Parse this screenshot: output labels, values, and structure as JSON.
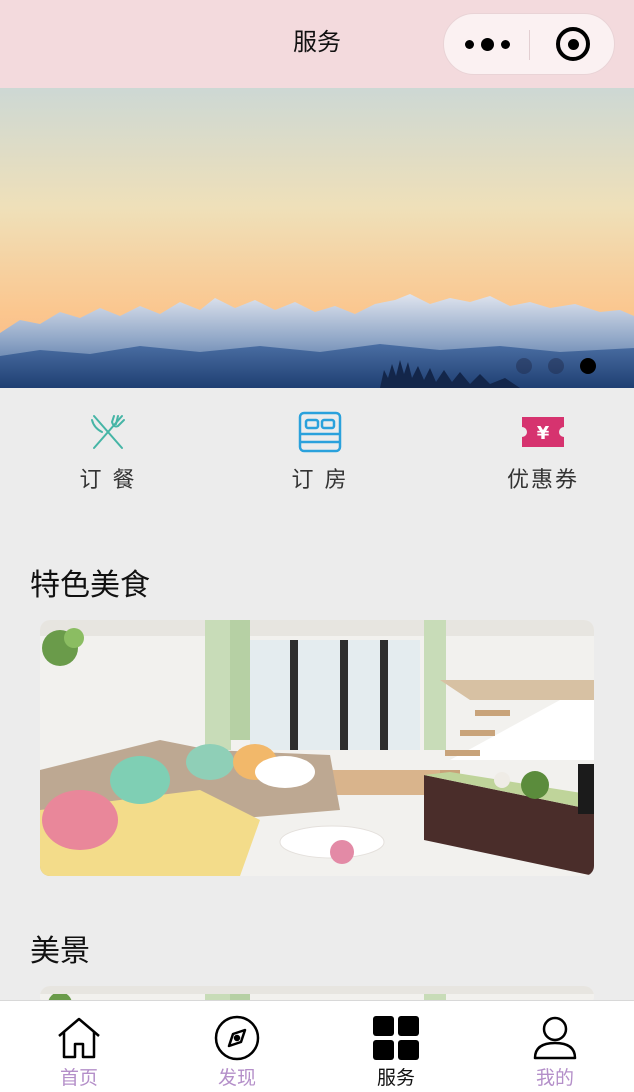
{
  "header": {
    "title": "服务"
  },
  "banner": {
    "slides": 3,
    "active_slide": 3
  },
  "services": [
    {
      "label": "订 餐",
      "icon": "fork-knife-icon"
    },
    {
      "label": "订 房",
      "icon": "bed-icon"
    },
    {
      "label": "优惠券",
      "icon": "coupon-icon"
    }
  ],
  "sections": [
    {
      "title": "特色美食"
    },
    {
      "title": "美景"
    }
  ],
  "coupon_glyph": "¥",
  "tabbar": {
    "items": [
      {
        "label": "首页",
        "icon": "home-icon"
      },
      {
        "label": "发现",
        "icon": "compass-icon"
      },
      {
        "label": "服务",
        "icon": "grid-icon",
        "active": true
      },
      {
        "label": "我的",
        "icon": "user-icon"
      }
    ],
    "active_color": "#111111",
    "inactive_color": "#b48fc9"
  }
}
